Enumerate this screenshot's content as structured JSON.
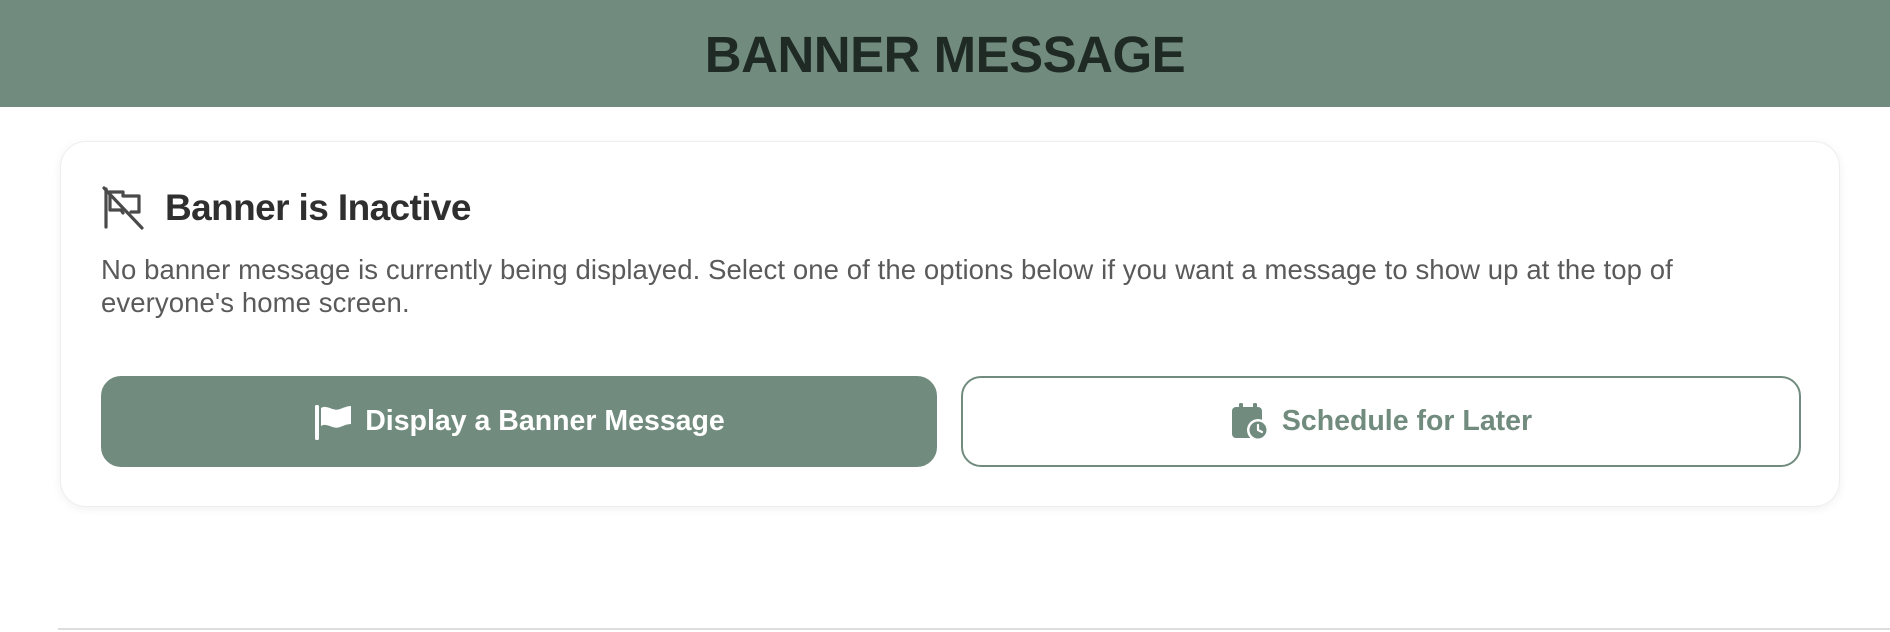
{
  "header": {
    "title": "BANNER MESSAGE",
    "background_color": "#718c7e"
  },
  "status": {
    "icon": "flag-off-icon",
    "title": "Banner is Inactive",
    "description": "No banner message is currently being displayed. Select one of the options below if you want a message to show up at the top of everyone's home screen."
  },
  "actions": {
    "display": {
      "label": "Display a Banner Message",
      "icon": "flag-icon"
    },
    "schedule": {
      "label": "Schedule for Later",
      "icon": "calendar-clock-icon"
    }
  },
  "colors": {
    "accent": "#718c7e",
    "title_text": "#1f2a25",
    "body_text": "#5a5a5a"
  }
}
